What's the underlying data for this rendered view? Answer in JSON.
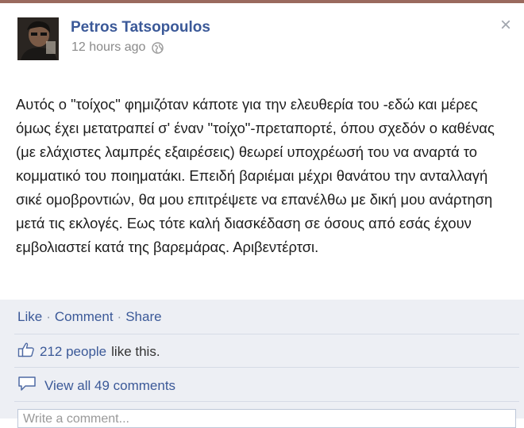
{
  "post": {
    "author": "Petros Tatsopoulos",
    "timestamp": "12 hours ago",
    "close_symbol": "×",
    "body": "Αυτός ο \"τοίχος\" φημιζόταν κάποτε για την ελευθερία του -εδώ και μέρες όμως έχει μετατραπεί σ' έναν \"τοίχο\"-πρεταπορτέ, όπου σχεδόν ο καθένας (με ελάχιστες λαμπρές εξαιρέσεις) θεωρεί υποχρέωσή του να αναρτά το κομματικό του ποιηματάκι. Επειδή βαριέμαι μέχρι θανάτου την ανταλλαγή σικέ ομοβροντιών, θα μου επιτρέψετε να επανέλθω με δική μου ανάρτηση μετά τις εκλογές. Εως τότε καλή διασκέδαση σε όσους από εσάς έχουν εμβολιαστεί κατά της βαρεμάρας. Αριβεντέρτσι."
  },
  "actions": {
    "like": "Like",
    "comment": "Comment",
    "share": "Share",
    "separator": "·"
  },
  "likes": {
    "count": "212 people",
    "suffix": "like this."
  },
  "comments": {
    "view_all": "View all 49 comments"
  },
  "comment_input": {
    "placeholder": "Write a comment..."
  },
  "icons": {
    "globe": "globe-icon",
    "thumbs_up": "thumbs-up-icon",
    "speech_bubble": "speech-bubble-icon",
    "close": "close-icon"
  },
  "colors": {
    "link": "#3b5998",
    "footer_bg": "#edeff4",
    "top_strip": "#9a6a5e"
  }
}
